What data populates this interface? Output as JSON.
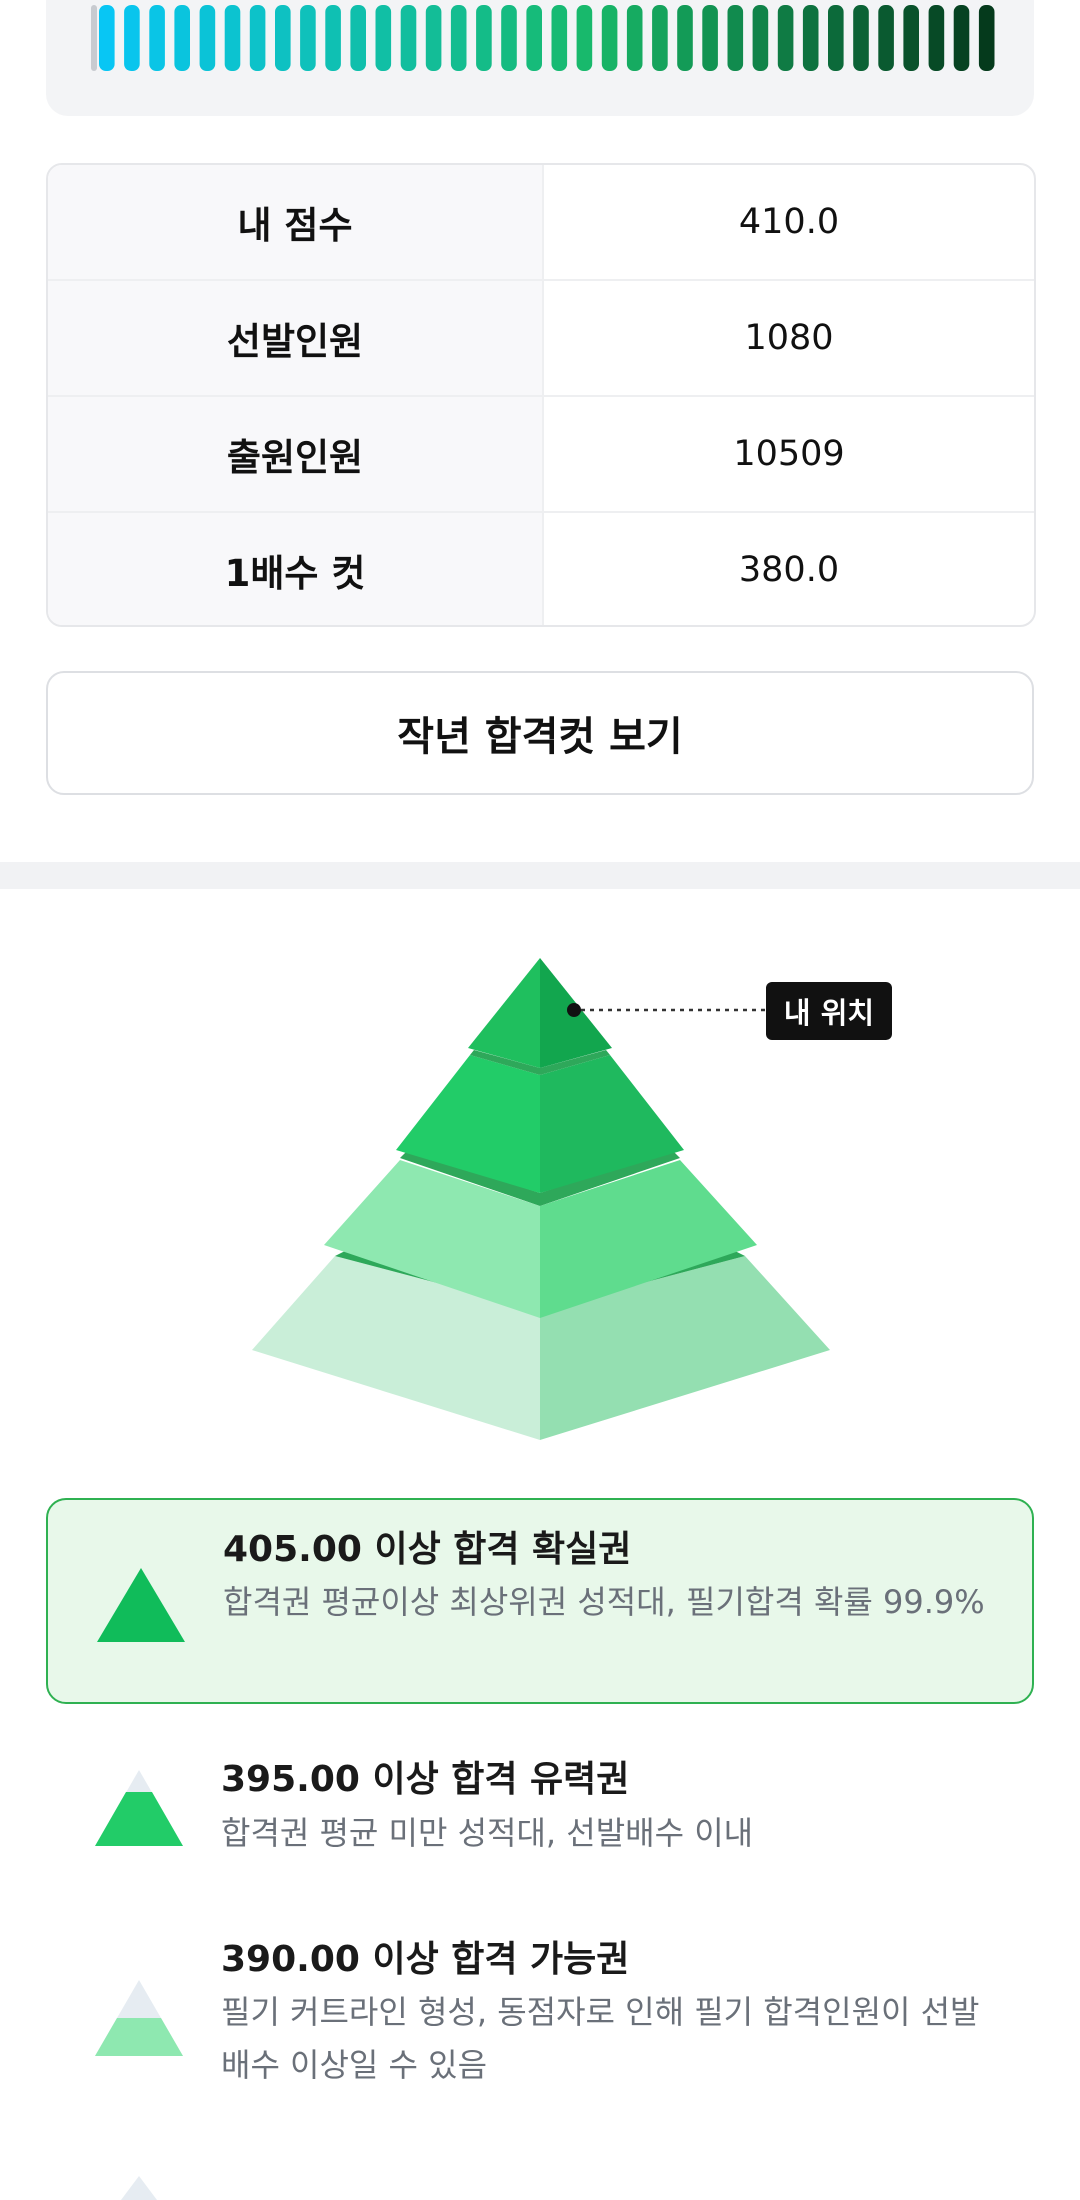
{
  "info_table": {
    "rows": [
      {
        "label": "내 점수",
        "value": "410.0"
      },
      {
        "label": "선발인원",
        "value": "1080"
      },
      {
        "label": "출원인원",
        "value": "10509"
      },
      {
        "label": "1배수 컷",
        "value": "380.0"
      }
    ]
  },
  "buttons": {
    "last_year_cut": "작년 합격컷 보기"
  },
  "gauge": {
    "bar_count": 36,
    "colors": {
      "start": "#08c6f4",
      "mid": "#18b96a",
      "end": "#053a1c"
    }
  },
  "pyramid": {
    "my_position_label": "내 위치",
    "colors": {
      "tier1_left": "#1fbf5e",
      "tier1_right": "#12a64e",
      "tier2_left": "#22cc68",
      "tier2_right": "#1fb95e",
      "tier3_left": "#8ee8b0",
      "tier3_right": "#5fdc8e",
      "tier4_left": "#c9eed8",
      "tier4_right": "#94dfb1",
      "rim": "#2ea85a"
    }
  },
  "tiers": [
    {
      "title": "405.00 이상 합격 확실권",
      "desc": "합격권 평균이상 최상위권 성적대, 필기합격 확률 99.9%",
      "active": true
    },
    {
      "title": "395.00 이상 합격 유력권",
      "desc": "합격권 평균 미만 성적대, 선발배수 이내",
      "active": false
    },
    {
      "title": "390.00 이상 합격 가능권",
      "desc": "필기 커트라인 형성, 동점자로 인해 필기 합격인원이 선발배수 이상일 수 있음",
      "active": false
    }
  ]
}
